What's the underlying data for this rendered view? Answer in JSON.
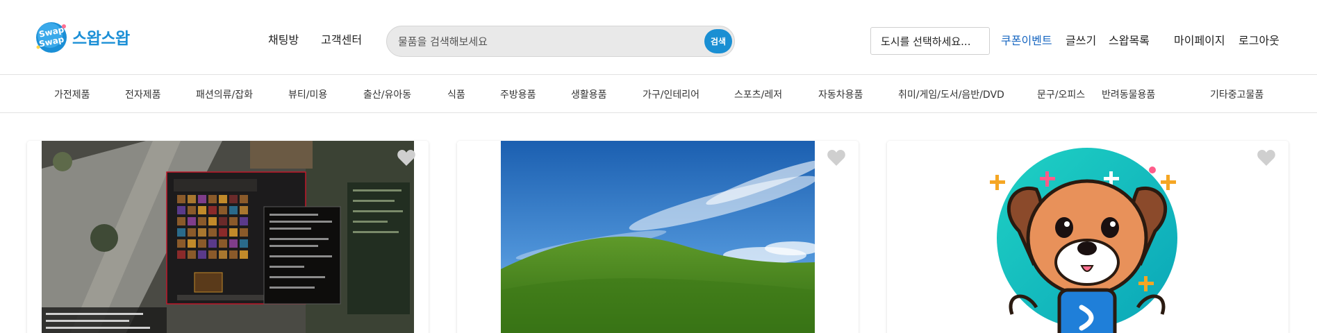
{
  "brand": {
    "name": "스왑스왑",
    "badge_line1": "Swap",
    "badge_line2": "Swap"
  },
  "nav_left": {
    "chat": "채팅방",
    "support": "고객센터"
  },
  "search": {
    "placeholder": "물품을 검색해보세요",
    "value": "",
    "button_label": "검색"
  },
  "city_select": {
    "selected": "도시를 선택하세요..."
  },
  "nav_right": {
    "coupon": "쿠폰이벤트",
    "write": "글쓰기",
    "swap_list": "스왑목록",
    "mypage": "마이페이지",
    "logout": "로그아웃"
  },
  "categories": [
    "가전제품",
    "전자제품",
    "패션의류/잡화",
    "뷰티/미용",
    "출산/유아동",
    "식품",
    "주방용품",
    "생활용품",
    "가구/인테리어",
    "스포츠/레저",
    "자동차용품",
    "취미/게임/도서/음반/DVD",
    "문구/오피스",
    "반려동물용품",
    "기타중고물품"
  ],
  "cards": [
    {
      "image": "game-screenshot",
      "liked": false
    },
    {
      "image": "green-hill-landscape",
      "liked": false
    },
    {
      "image": "cartoon-dog-logo",
      "liked": false
    }
  ],
  "colors": {
    "accent": "#1a8fd3",
    "link_accent": "#1565c0",
    "heart": "#cfcfcf"
  }
}
